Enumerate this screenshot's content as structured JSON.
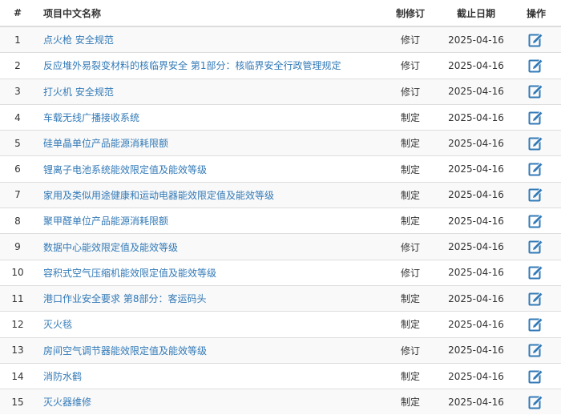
{
  "table": {
    "headers": {
      "index": "#",
      "name": "项目中文名称",
      "type": "制修订",
      "deadline": "截止日期",
      "action": "操作"
    },
    "action_icon": "edit-icon",
    "accent_color": "#337ab7",
    "rows": [
      {
        "index": "1",
        "name": "点火枪 安全规范",
        "type": "修订",
        "deadline": "2025-04-16"
      },
      {
        "index": "2",
        "name": "反应堆外易裂变材料的核临界安全 第1部分：核临界安全行政管理规定",
        "type": "修订",
        "deadline": "2025-04-16"
      },
      {
        "index": "3",
        "name": "打火机 安全规范",
        "type": "修订",
        "deadline": "2025-04-16"
      },
      {
        "index": "4",
        "name": "车载无线广播接收系统",
        "type": "制定",
        "deadline": "2025-04-16"
      },
      {
        "index": "5",
        "name": "硅单晶单位产品能源消耗限额",
        "type": "制定",
        "deadline": "2025-04-16"
      },
      {
        "index": "6",
        "name": "锂离子电池系统能效限定值及能效等级",
        "type": "制定",
        "deadline": "2025-04-16"
      },
      {
        "index": "7",
        "name": "家用及类似用途健康和运动电器能效限定值及能效等级",
        "type": "制定",
        "deadline": "2025-04-16"
      },
      {
        "index": "8",
        "name": "聚甲醛单位产品能源消耗限额",
        "type": "制定",
        "deadline": "2025-04-16"
      },
      {
        "index": "9",
        "name": "数据中心能效限定值及能效等级",
        "type": "修订",
        "deadline": "2025-04-16"
      },
      {
        "index": "10",
        "name": "容积式空气压缩机能效限定值及能效等级",
        "type": "修订",
        "deadline": "2025-04-16"
      },
      {
        "index": "11",
        "name": "港口作业安全要求 第8部分：客运码头",
        "type": "制定",
        "deadline": "2025-04-16"
      },
      {
        "index": "12",
        "name": "灭火毯",
        "type": "制定",
        "deadline": "2025-04-16"
      },
      {
        "index": "13",
        "name": "房间空气调节器能效限定值及能效等级",
        "type": "修订",
        "deadline": "2025-04-16"
      },
      {
        "index": "14",
        "name": "消防水鹤",
        "type": "制定",
        "deadline": "2025-04-16"
      },
      {
        "index": "15",
        "name": "灭火器维修",
        "type": "制定",
        "deadline": "2025-04-16"
      }
    ]
  }
}
